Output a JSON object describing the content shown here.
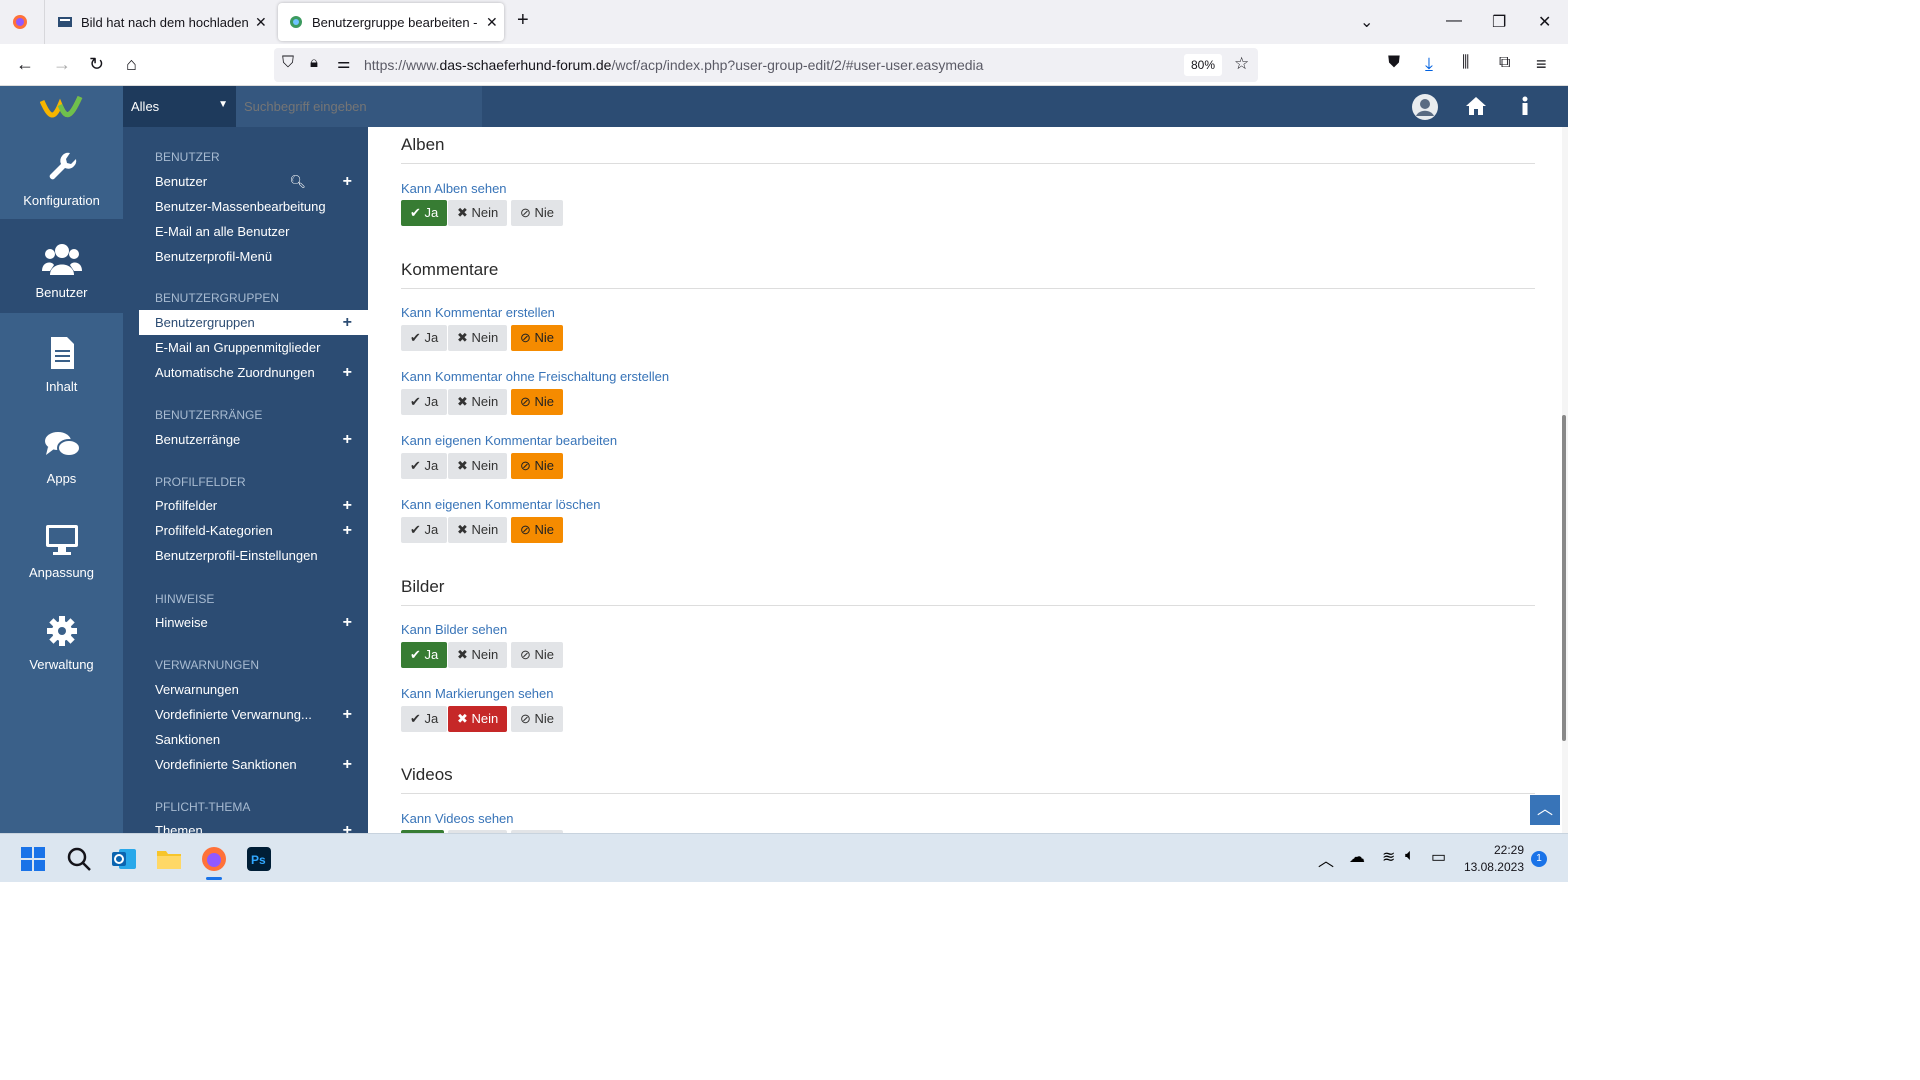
{
  "browser": {
    "tabs": [
      {
        "title": "Bild hat nach dem hochladen ei"
      },
      {
        "title": "Benutzergruppe bearbeiten - A"
      }
    ],
    "url_prefix": "https://www.",
    "url_domain": "das-schaeferhund-forum.de",
    "url_path": "/wcf/acp/index.php?user-group-edit/2/#user-user.easymedia",
    "zoom": "80%"
  },
  "header": {
    "search_scope": "Alles",
    "search_placeholder": "Suchbegriff eingeben"
  },
  "mainmenu": [
    {
      "label": "Konfiguration",
      "icon": "wrench-icon"
    },
    {
      "label": "Benutzer",
      "icon": "users-icon"
    },
    {
      "label": "Inhalt",
      "icon": "document-icon"
    },
    {
      "label": "Apps",
      "icon": "chat-icon"
    },
    {
      "label": "Anpassung",
      "icon": "monitor-icon"
    },
    {
      "label": "Verwaltung",
      "icon": "gear-icon"
    }
  ],
  "submenu": {
    "sections": [
      {
        "title": "Benutzer"
      },
      {
        "title": "Benutzergruppen"
      },
      {
        "title": "Benutzerränge"
      },
      {
        "title": "Profilfelder"
      },
      {
        "title": "Hinweise"
      },
      {
        "title": "Verwarnungen"
      },
      {
        "title": "Pflicht-Thema"
      }
    ],
    "items": [
      {
        "label": "Benutzer"
      },
      {
        "label": "Benutzer-Massenbearbeitung"
      },
      {
        "label": "E-Mail an alle Benutzer"
      },
      {
        "label": "Benutzerprofil-Menü"
      },
      {
        "label": "Benutzergruppen"
      },
      {
        "label": "E-Mail an Gruppenmitglieder"
      },
      {
        "label": "Automatische Zuordnungen"
      },
      {
        "label": "Benutzerränge"
      },
      {
        "label": "Profilfelder"
      },
      {
        "label": "Profilfeld-Kategorien"
      },
      {
        "label": "Benutzerprofil-Einstellungen"
      },
      {
        "label": "Hinweise"
      },
      {
        "label": "Verwarnungen"
      },
      {
        "label": "Vordefinierte Verwarnung..."
      },
      {
        "label": "Sanktionen"
      },
      {
        "label": "Vordefinierte Sanktionen"
      },
      {
        "label": "Themen"
      }
    ]
  },
  "content": {
    "buttons": {
      "ja": "Ja",
      "nein": "Nein",
      "nie": "Nie"
    },
    "sections": [
      {
        "title": "Alben",
        "options": [
          {
            "label": "Kann Alben sehen",
            "selected": "ja"
          }
        ]
      },
      {
        "title": "Kommentare",
        "options": [
          {
            "label": "Kann Kommentar erstellen",
            "selected": "nie"
          },
          {
            "label": "Kann Kommentar ohne Freischaltung erstellen",
            "selected": "nie"
          },
          {
            "label": "Kann eigenen Kommentar bearbeiten",
            "selected": "nie"
          },
          {
            "label": "Kann eigenen Kommentar löschen",
            "selected": "nie"
          }
        ]
      },
      {
        "title": "Bilder",
        "options": [
          {
            "label": "Kann Bilder sehen",
            "selected": "ja"
          },
          {
            "label": "Kann Markierungen sehen",
            "selected": "nein"
          }
        ]
      },
      {
        "title": "Videos",
        "options": [
          {
            "label": "Kann Videos sehen",
            "selected": "ja"
          }
        ]
      }
    ]
  },
  "taskbar": {
    "time": "22:29",
    "date": "13.08.2023",
    "notifications": "1"
  },
  "colors": {
    "header": "#2c4c73",
    "mainmenu": "#3a6089",
    "ja_selected": "#377c33",
    "nein_selected": "#c62828",
    "nie_selected": "#f58b00",
    "link": "#3874b8"
  }
}
